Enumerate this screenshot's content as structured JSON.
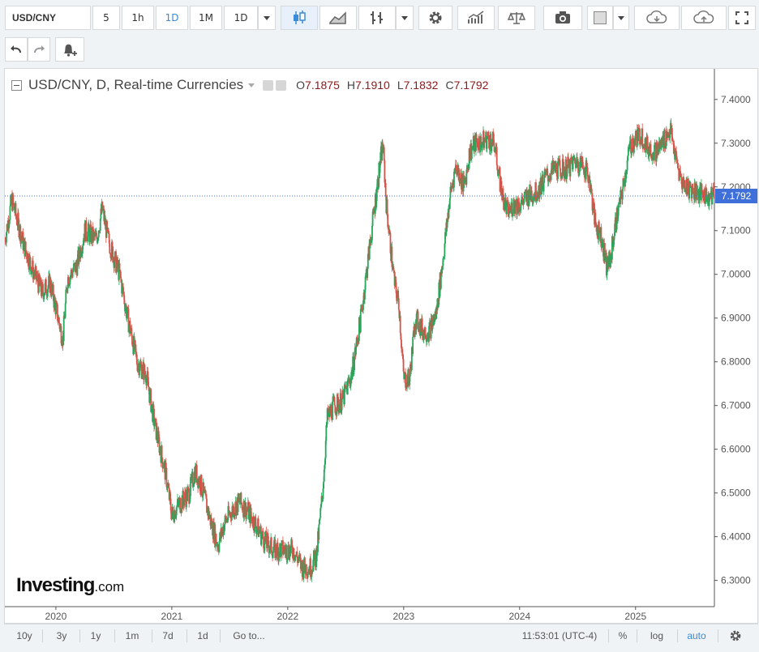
{
  "toolbar": {
    "symbol": "USD/CNY",
    "intervals": [
      "5",
      "1h",
      "1D",
      "1M",
      "1D"
    ],
    "active_interval_index": 2
  },
  "legend": {
    "title": "USD/CNY, D, Real-time Currencies",
    "open_label": "O",
    "open": "7.1875",
    "high_label": "H",
    "high": "7.1910",
    "low_label": "L",
    "low": "7.1832",
    "close_label": "C",
    "close": "7.1792"
  },
  "logo": {
    "main": "Investing",
    "suffix": ".com"
  },
  "price_tag": "7.1792",
  "bottom_bar": {
    "ranges": [
      "10y",
      "3y",
      "1y",
      "1m",
      "7d",
      "1d"
    ],
    "goto": "Go to...",
    "time": "11:53:01 (UTC-4)",
    "percent": "%",
    "log": "log",
    "auto": "auto"
  },
  "colors": {
    "up": "#26a65b",
    "down": "#d5544a",
    "price_line": "#3f6fd8",
    "accent": "#3a8bd8"
  },
  "chart_data": {
    "type": "candlestick",
    "title": "USD/CNY, D, Real-time Currencies",
    "x_ticks": [
      "2020",
      "2021",
      "2022",
      "2023",
      "2024",
      "2025"
    ],
    "y_ticks": [
      "7.4000",
      "7.3000",
      "7.2000",
      "7.1000",
      "7.0000",
      "6.9000",
      "6.8000",
      "6.7000",
      "6.6000",
      "6.5000",
      "6.4000",
      "6.3000"
    ],
    "ylim": [
      6.24,
      7.47
    ],
    "last_price": 7.1792,
    "x_range": [
      2019.56,
      2025.68
    ],
    "path": [
      [
        2019.56,
        7.08
      ],
      [
        2019.62,
        7.17
      ],
      [
        2019.72,
        7.07
      ],
      [
        2019.8,
        7.01
      ],
      [
        2019.88,
        6.96
      ],
      [
        2019.95,
        6.98
      ],
      [
        2020.02,
        6.9
      ],
      [
        2020.06,
        6.85
      ],
      [
        2020.1,
        6.99
      ],
      [
        2020.18,
        7.02
      ],
      [
        2020.25,
        7.1
      ],
      [
        2020.35,
        7.08
      ],
      [
        2020.4,
        7.15
      ],
      [
        2020.45,
        7.08
      ],
      [
        2020.55,
        7.0
      ],
      [
        2020.62,
        6.9
      ],
      [
        2020.7,
        6.8
      ],
      [
        2020.78,
        6.77
      ],
      [
        2020.85,
        6.66
      ],
      [
        2020.95,
        6.54
      ],
      [
        2021.0,
        6.45
      ],
      [
        2021.05,
        6.47
      ],
      [
        2021.15,
        6.5
      ],
      [
        2021.2,
        6.55
      ],
      [
        2021.25,
        6.52
      ],
      [
        2021.33,
        6.44
      ],
      [
        2021.4,
        6.38
      ],
      [
        2021.45,
        6.43
      ],
      [
        2021.52,
        6.46
      ],
      [
        2021.58,
        6.48
      ],
      [
        2021.65,
        6.46
      ],
      [
        2021.72,
        6.43
      ],
      [
        2021.8,
        6.39
      ],
      [
        2021.88,
        6.37
      ],
      [
        2021.95,
        6.37
      ],
      [
        2022.05,
        6.37
      ],
      [
        2022.12,
        6.33
      ],
      [
        2022.2,
        6.33
      ],
      [
        2022.25,
        6.36
      ],
      [
        2022.3,
        6.5
      ],
      [
        2022.34,
        6.67
      ],
      [
        2022.4,
        6.7
      ],
      [
        2022.47,
        6.71
      ],
      [
        2022.55,
        6.77
      ],
      [
        2022.63,
        6.9
      ],
      [
        2022.7,
        7.05
      ],
      [
        2022.77,
        7.2
      ],
      [
        2022.82,
        7.3
      ],
      [
        2022.85,
        7.16
      ],
      [
        2022.88,
        7.08
      ],
      [
        2022.92,
        6.98
      ],
      [
        2022.96,
        6.93
      ],
      [
        2023.0,
        6.76
      ],
      [
        2023.05,
        6.76
      ],
      [
        2023.1,
        6.9
      ],
      [
        2023.17,
        6.87
      ],
      [
        2023.22,
        6.87
      ],
      [
        2023.28,
        6.91
      ],
      [
        2023.35,
        7.06
      ],
      [
        2023.4,
        7.18
      ],
      [
        2023.45,
        7.25
      ],
      [
        2023.52,
        7.2
      ],
      [
        2023.57,
        7.28
      ],
      [
        2023.62,
        7.3
      ],
      [
        2023.67,
        7.3
      ],
      [
        2023.72,
        7.31
      ],
      [
        2023.78,
        7.3
      ],
      [
        2023.85,
        7.18
      ],
      [
        2023.9,
        7.14
      ],
      [
        2023.95,
        7.16
      ],
      [
        2024.0,
        7.16
      ],
      [
        2024.08,
        7.18
      ],
      [
        2024.15,
        7.19
      ],
      [
        2024.22,
        7.22
      ],
      [
        2024.3,
        7.24
      ],
      [
        2024.4,
        7.24
      ],
      [
        2024.48,
        7.26
      ],
      [
        2024.55,
        7.25
      ],
      [
        2024.6,
        7.22
      ],
      [
        2024.65,
        7.12
      ],
      [
        2024.7,
        7.09
      ],
      [
        2024.75,
        7.02
      ],
      [
        2024.78,
        7.03
      ],
      [
        2024.83,
        7.12
      ],
      [
        2024.88,
        7.18
      ],
      [
        2024.95,
        7.29
      ],
      [
        2025.0,
        7.31
      ],
      [
        2025.05,
        7.32
      ],
      [
        2025.1,
        7.29
      ],
      [
        2025.18,
        7.28
      ],
      [
        2025.25,
        7.31
      ],
      [
        2025.3,
        7.33
      ],
      [
        2025.35,
        7.26
      ],
      [
        2025.4,
        7.21
      ],
      [
        2025.45,
        7.2
      ],
      [
        2025.52,
        7.19
      ],
      [
        2025.6,
        7.18
      ],
      [
        2025.68,
        7.18
      ]
    ]
  }
}
